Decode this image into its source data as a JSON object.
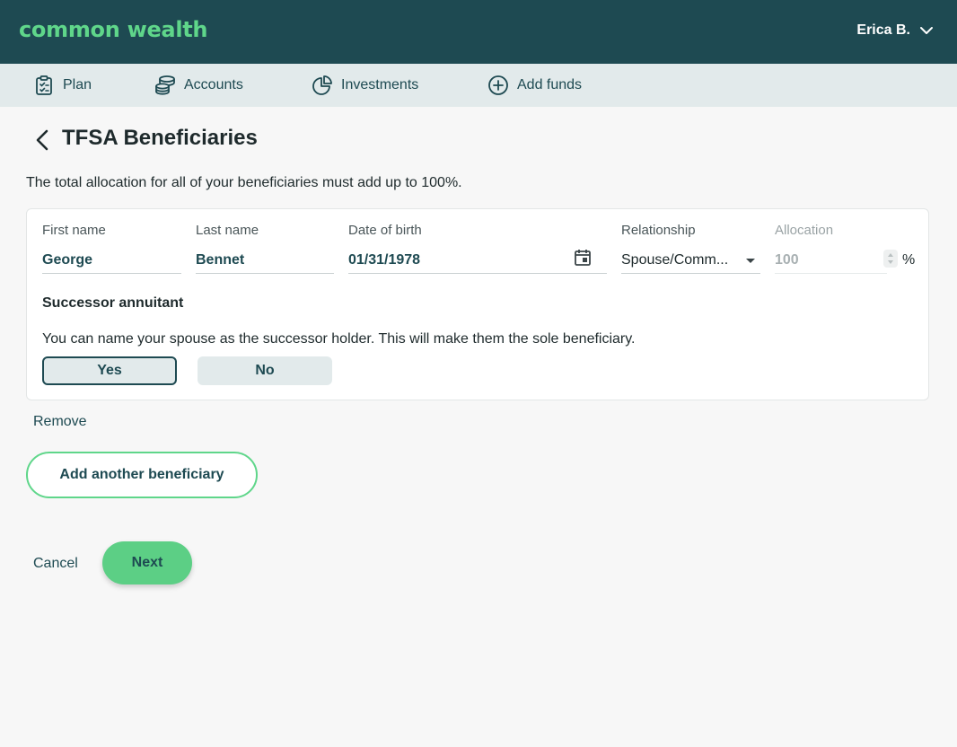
{
  "header": {
    "logo": {
      "part1": "co",
      "part2": "mmon",
      "part3": " wealth"
    },
    "user_name": "Erica B."
  },
  "nav": [
    {
      "label": "Plan",
      "icon": "clipboard-icon"
    },
    {
      "label": "Accounts",
      "icon": "coins-icon"
    },
    {
      "label": "Investments",
      "icon": "pie-chart-icon"
    },
    {
      "label": "Add funds",
      "icon": "plus-circle-icon"
    }
  ],
  "page": {
    "title": "TFSA Beneficiaries",
    "intro": "The total allocation for all of your beneficiaries must add up to 100%."
  },
  "beneficiary": {
    "first_name_label": "First name",
    "first_name": "George",
    "last_name_label": "Last name",
    "last_name": "Bennet",
    "dob_label": "Date of birth",
    "dob": "01/31/1978",
    "relationship_label": "Relationship",
    "relationship": "Spouse/Comm...",
    "allocation_label": "Allocation",
    "allocation": "100",
    "allocation_unit": "%",
    "successor_title": "Successor annuitant",
    "successor_text": "You can name your spouse as the successor holder. This will make them the sole beneficiary.",
    "yes_label": "Yes",
    "no_label": "No",
    "selected": "Yes",
    "remove_label": "Remove"
  },
  "actions": {
    "add_label": "Add another beneficiary",
    "cancel_label": "Cancel",
    "next_label": "Next"
  },
  "colors": {
    "header_bg": "#1e4a52",
    "nav_bg": "#e2eaeb",
    "accent_green": "#5ccf85",
    "text_teal": "#1e4a52"
  }
}
